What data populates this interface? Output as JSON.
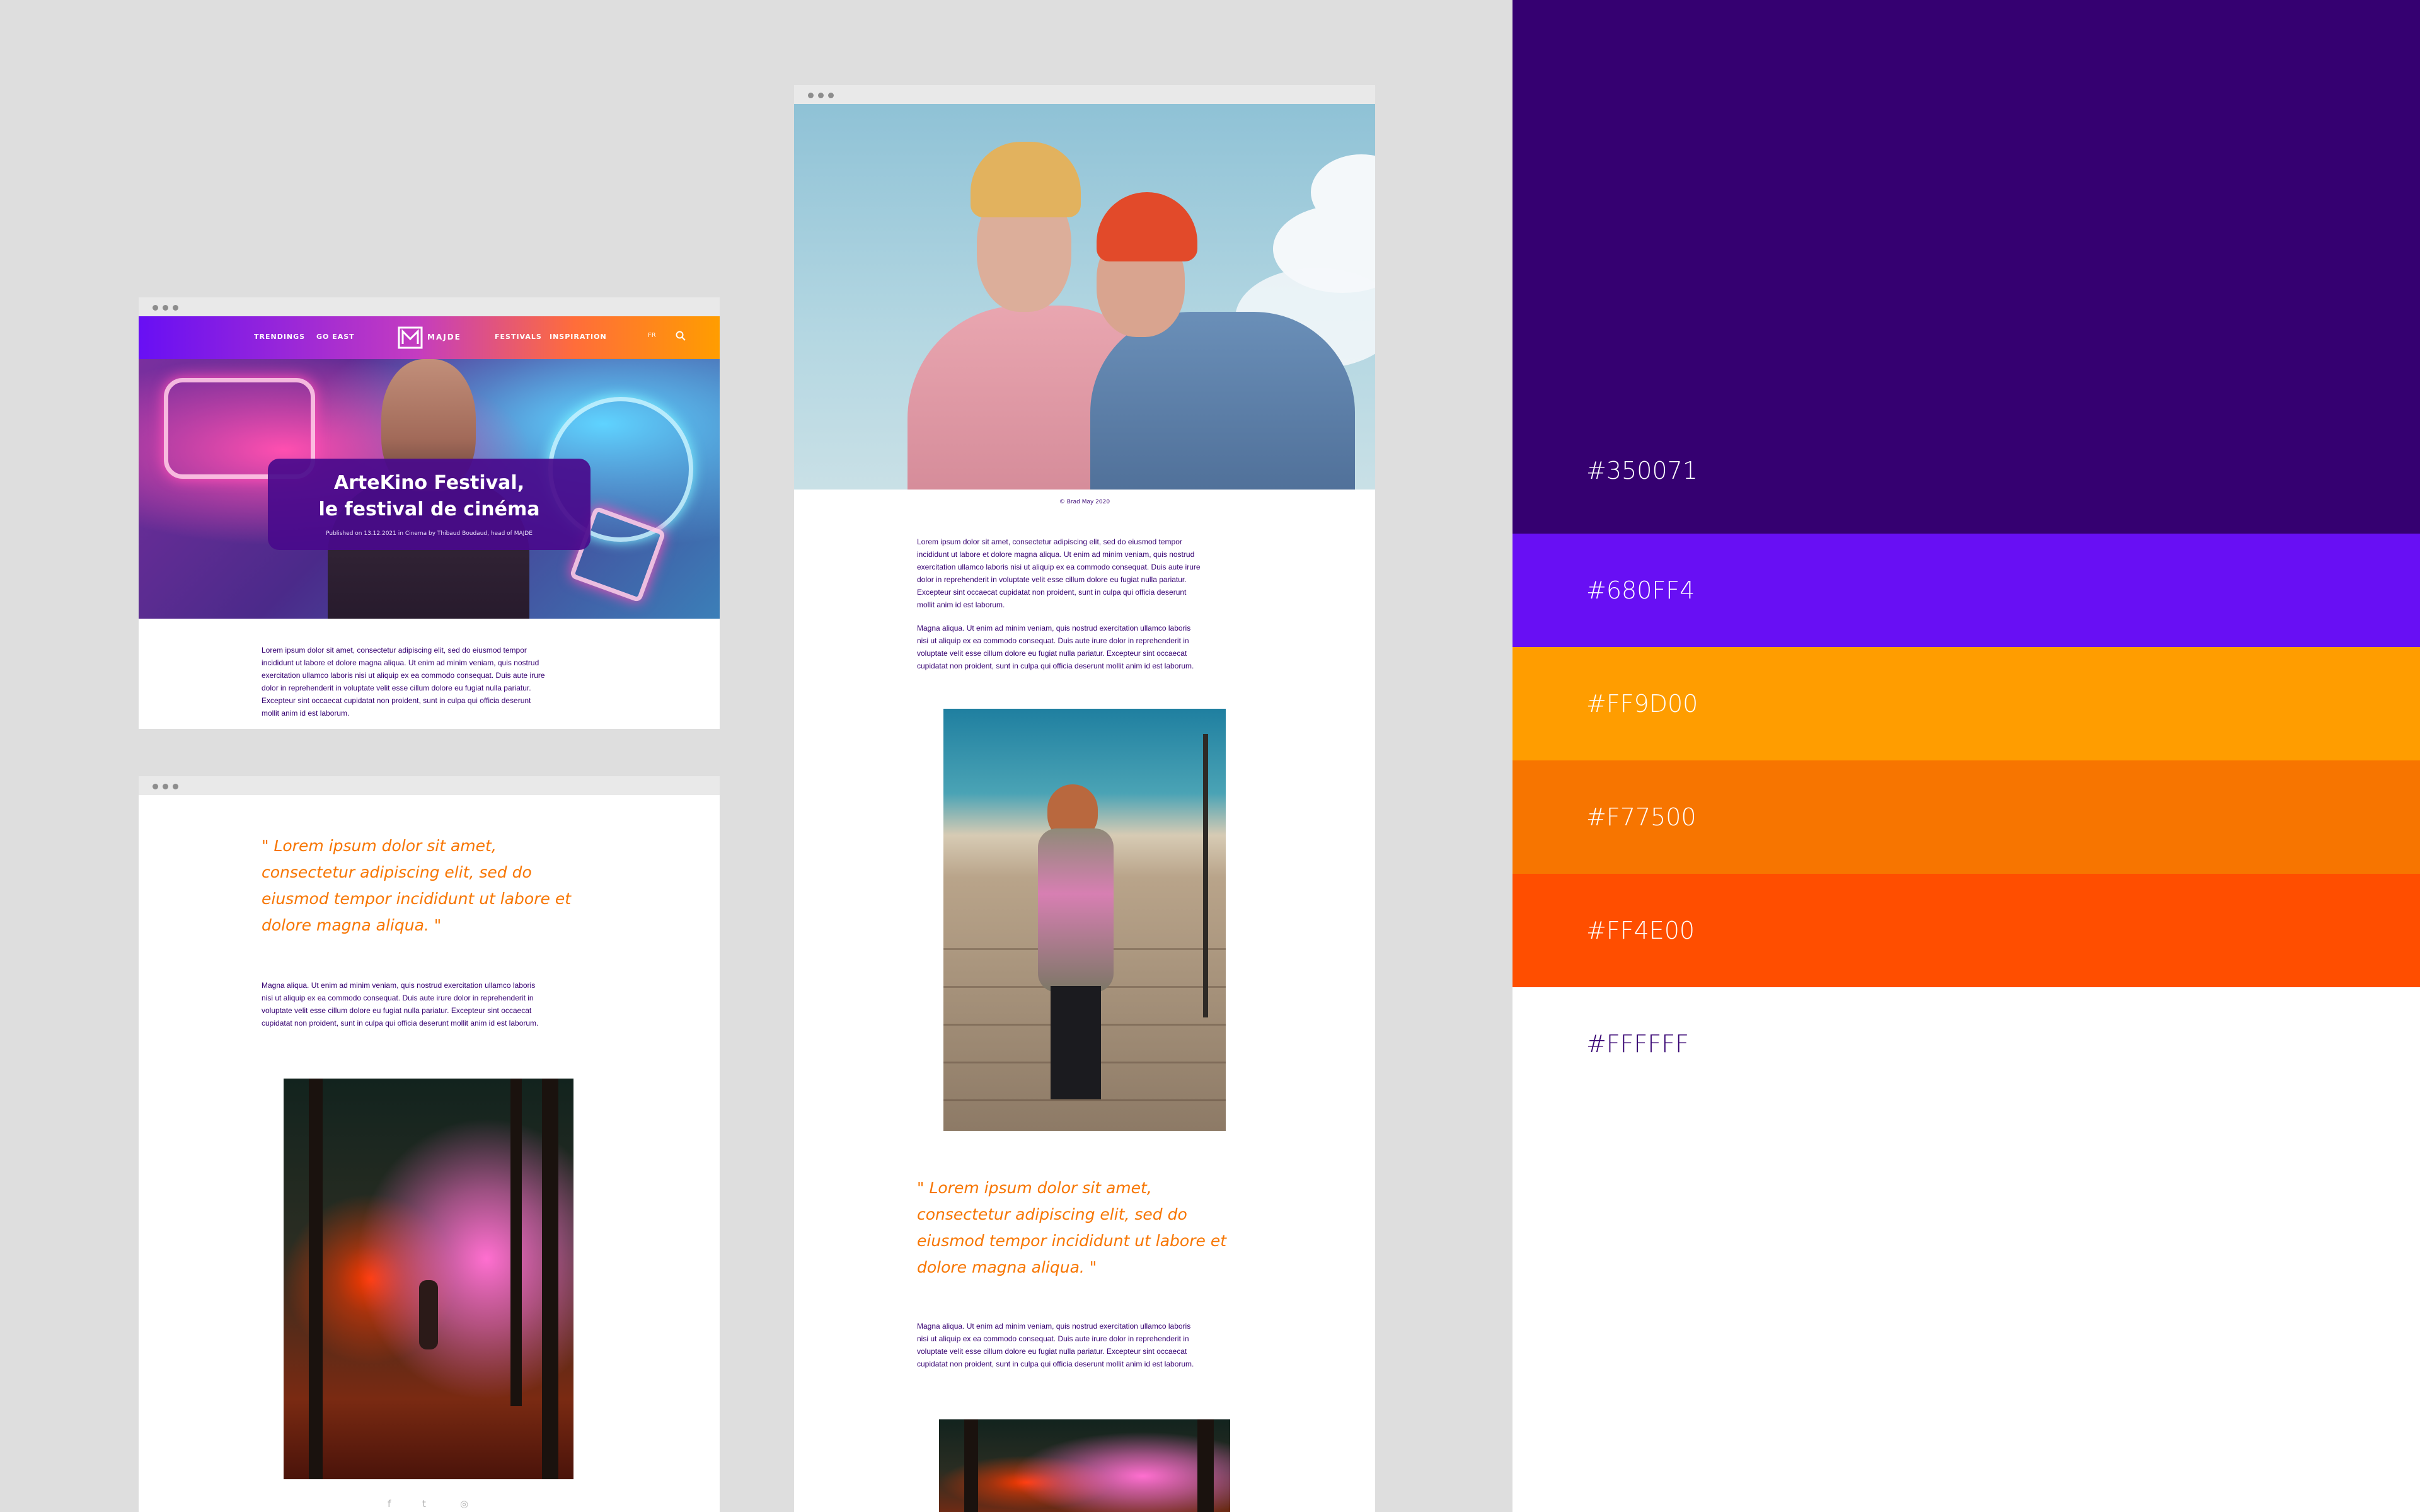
{
  "window_article": {
    "nav": {
      "links": [
        "TRENDINGS",
        "GO EAST",
        "FESTIVALS",
        "INSPIRATION"
      ],
      "brand": "MAJDE",
      "lang": "FR"
    },
    "hero": {
      "title_line1": "ArteKino Festival,",
      "title_line2": "le festival de cinéma",
      "meta": "Published on 13.12.2021 in Cinema by Thibaud Boudaud, head of MAJDE"
    },
    "body": [
      "Lorem ipsum dolor sit amet, consectetur adipiscing elit, sed do eiusmod tempor",
      "incididunt ut labore et dolore magna aliqua. Ut enim ad minim veniam, quis nostrud",
      "exercitation ullamco laboris nisi ut aliquip ex ea commodo consequat. Duis aute irure",
      "dolor in reprehenderit in voluptate velit esse cillum dolore eu fugiat nulla pariatur.",
      "Excepteur sint occaecat cupidatat non proident, sunt in culpa qui officia deserunt",
      "mollit anim id est laborum."
    ]
  },
  "window_quote": {
    "quote": [
      "\" Lorem ipsum dolor sit amet,",
      "consectetur adipiscing elit, sed do",
      "eiusmod tempor incididunt ut labore et",
      "dolore magna aliqua. \""
    ],
    "body": [
      "Magna aliqua. Ut enim ad minim veniam, quis nostrud exercitation ullamco laboris",
      "nisi ut aliquip ex ea commodo consequat. Duis aute irure dolor in reprehenderit in",
      "voluptate velit esse cillum dolore eu fugiat nulla pariatur. Excepteur sint occaecat",
      "cupidatat non proident, sunt in culpa qui officia deserunt mollit anim id est laborum."
    ],
    "social_icons": [
      "facebook-icon",
      "twitter-icon",
      "instagram-icon"
    ],
    "social_glyphs": [
      "f",
      "t",
      "◎"
    ]
  },
  "window_long": {
    "caption": "© Brad May 2020",
    "para1": [
      "Lorem ipsum dolor sit amet, consectetur adipiscing elit, sed do eiusmod tempor",
      "incididunt ut labore et dolore magna aliqua. Ut enim ad minim veniam, quis nostrud",
      "exercitation ullamco laboris nisi ut aliquip ex ea commodo consequat. Duis aute irure",
      "dolor in reprehenderit in voluptate velit esse cillum dolore eu fugiat nulla pariatur.",
      "Excepteur sint occaecat cupidatat non proident, sunt in culpa qui officia deserunt",
      "mollit anim id est laborum."
    ],
    "para2": [
      "Magna aliqua. Ut enim ad minim veniam, quis nostrud exercitation ullamco laboris",
      "nisi ut aliquip ex ea commodo consequat. Duis aute irure dolor in reprehenderit in",
      "voluptate velit esse cillum dolore eu fugiat nulla pariatur. Excepteur sint occaecat",
      "cupidatat non proident, sunt in culpa qui officia deserunt mollit anim id est laborum."
    ],
    "quote": [
      "\" Lorem ipsum dolor sit amet,",
      "consectetur adipiscing elit, sed do",
      "eiusmod tempor incididunt ut labore et",
      "dolore magna aliqua. \""
    ],
    "para3": [
      "Magna aliqua. Ut enim ad minim veniam, quis nostrud exercitation ullamco laboris",
      "nisi ut aliquip ex ea commodo consequat. Duis aute irure dolor in reprehenderit in",
      "voluptate velit esse cillum dolore eu fugiat nulla pariatur. Excepteur sint occaecat",
      "cupidatat non proident, sunt in culpa qui officia deserunt mollit anim id est laborum."
    ]
  },
  "palette": [
    {
      "hex": "#350071",
      "label": "#350071",
      "label_color": "#ffffff"
    },
    {
      "hex": "#680FF4",
      "label": "#680FF4",
      "label_color": "#ffffff"
    },
    {
      "hex": "#FF9D00",
      "label": "#FF9D00",
      "label_color": "#ffffff"
    },
    {
      "hex": "#F77500",
      "label": "#F77500",
      "label_color": "#ffffff"
    },
    {
      "hex": "#FF4E00",
      "label": "#FF4E00",
      "label_color": "#ffffff"
    },
    {
      "hex": "#FFFFFF",
      "label": "#FFFFFF",
      "label_color": "#350071"
    }
  ]
}
